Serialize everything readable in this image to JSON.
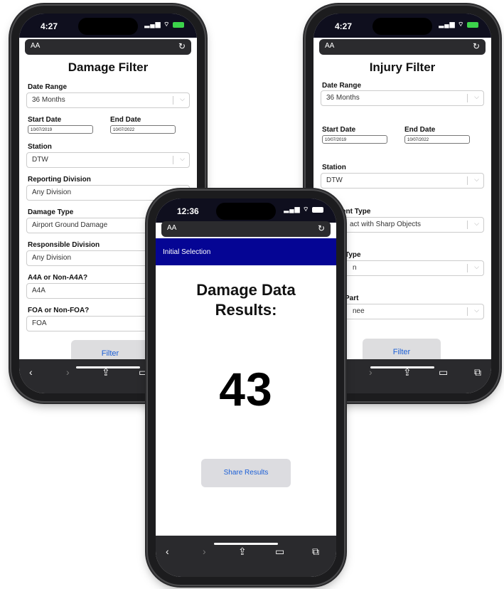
{
  "damage_phone": {
    "status_time": "4:27",
    "url_aa": "AA",
    "title": "Damage Filter",
    "fields": [
      {
        "label": "Date Range",
        "value": "36 Months"
      },
      {
        "label": "Station",
        "value": "DTW"
      },
      {
        "label": "Reporting Division",
        "value": "Any Division"
      },
      {
        "label": "Damage Type",
        "value": "Airport Ground Damage"
      },
      {
        "label": "Responsible Division",
        "value": "Any Division"
      },
      {
        "label": "A4A or Non-A4A?",
        "value": "A4A"
      },
      {
        "label": "FOA or Non-FOA?",
        "value": "FOA"
      }
    ],
    "start_label": "Start Date",
    "start_value": "10/07/2019",
    "end_label": "End Date",
    "end_value": "10/07/2022",
    "filter_label": "Filter"
  },
  "injury_phone": {
    "status_time": "4:27",
    "url_aa": "AA",
    "title": "Injury Filter",
    "fields": [
      {
        "label": "Date Range",
        "value": "36 Months"
      },
      {
        "label": "Station",
        "value": "DTW"
      },
      {
        "label": "ent Type",
        "value": "act with Sharp Objects"
      },
      {
        "label": "Type",
        "value": "n"
      },
      {
        "label": "Part",
        "value": "nee"
      }
    ],
    "start_label": "Start Date",
    "start_value": "10/07/2019",
    "end_label": "End Date",
    "end_value": "10/07/2022",
    "filter_label": "Filter"
  },
  "results_phone": {
    "status_time": "12:36",
    "url_aa": "AA",
    "nav_label": "Initial Selection",
    "title": "Damage Data Results:",
    "count": "43",
    "share_label": "Share Results"
  },
  "toolbar_icons": [
    "back-icon",
    "forward-icon",
    "share-icon",
    "bookmarks-icon",
    "tabs-icon"
  ],
  "colors": {
    "nav_blue": "#050594",
    "button_text": "#1c5fd6",
    "battery_green": "#3cd34b"
  }
}
